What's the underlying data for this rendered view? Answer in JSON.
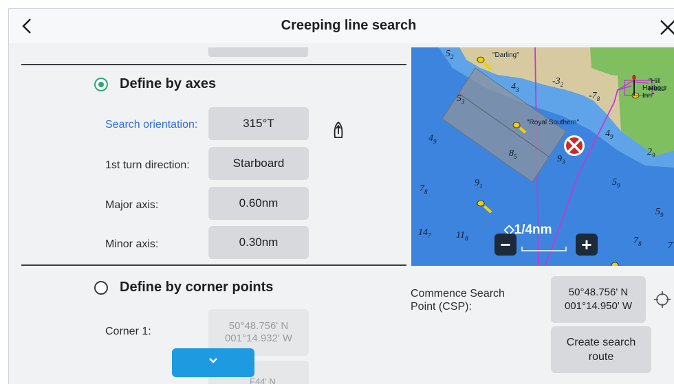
{
  "header": {
    "title": "Creeping line search",
    "back_icon": "chevron-left-icon",
    "close_icon": "close-icon"
  },
  "axes_section": {
    "title": "Define by axes",
    "selected": true,
    "fields": [
      {
        "label": "Search orientation:",
        "value": "315°T",
        "active": true
      },
      {
        "label": "1st turn direction:",
        "value": "Starboard"
      },
      {
        "label": "Major axis:",
        "value": "0.60nm"
      },
      {
        "label": "Minor axis:",
        "value": "0.30nm"
      }
    ],
    "orientation_icon": "boat-heading-icon"
  },
  "corners_section": {
    "title": "Define by corner points",
    "selected": false,
    "corner1_label": "Corner 1:",
    "corner1_lat": "50°48.756' N",
    "corner1_lon": "001°14.932' W",
    "corner2_partial": "F44' N"
  },
  "expand_icon": "chevron-down-icon",
  "map": {
    "labels": {
      "darling": "\"Darling\"",
      "royal_southern": "\"Royal Southern\"",
      "hill_head": "\"Hill Head",
      "harbour_inn": "Harbour Inn\""
    },
    "scale": "1/4nm",
    "zoom_out": "−",
    "zoom_in": "+",
    "depths": [
      "5₂",
      "4₃",
      "5₃",
      "-3₂",
      "-7₈",
      "4₉",
      "4₉",
      "2₉",
      "8₅",
      "9₃",
      "7₈",
      "9₁",
      "5₉",
      "5₉",
      "14₇",
      "11₈",
      "7₈",
      "7"
    ]
  },
  "csp": {
    "label_line1": "Commence Search",
    "label_line2": "Point (CSP):",
    "lat": "50°48.756' N",
    "lon": "001°14.950' W",
    "target_icon": "crosshair-icon"
  },
  "create_route": {
    "line1": "Create search",
    "line2": "route"
  },
  "colors": {
    "accent_green": "#2aa876",
    "active_blue": "#2f6fd6",
    "expand_blue": "#1e9be0",
    "sea": "#3d84de",
    "land": "#d8caa0"
  }
}
